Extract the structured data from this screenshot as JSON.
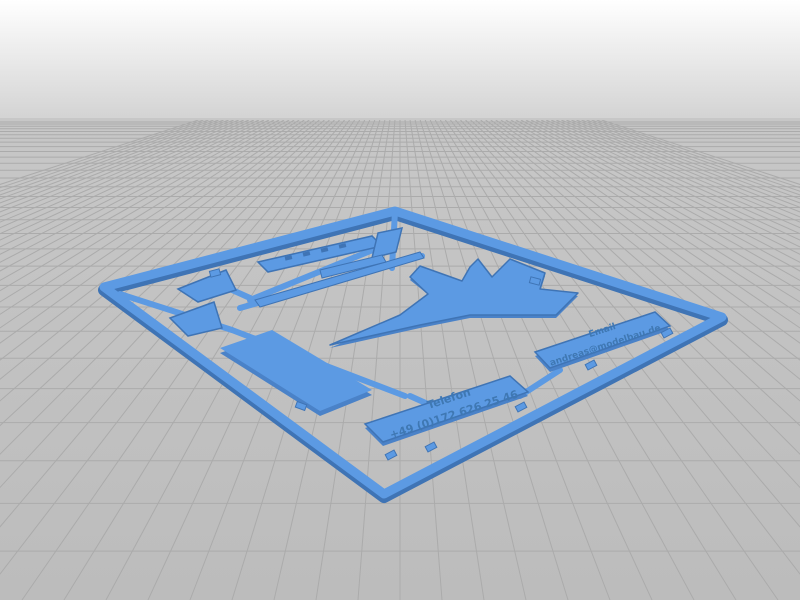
{
  "scene": {
    "subject": "3d-print-preview",
    "colors": {
      "sky_top": "#ffffff",
      "sky_bottom": "#d3d3d3",
      "floor": "#c0c0c0",
      "grid_line": "#a9a9a9",
      "part_fill": "#5c9ae3",
      "part_edge": "#3f74b5",
      "part_shadow": "#4a82c8"
    },
    "icons": {
      "aircraft": "jet-aircraft-icon"
    }
  },
  "plates": {
    "phone_label": "Telefon",
    "phone_number": "+49 (0)172 626 25 46",
    "email_label": "Email",
    "email_value": "andreas@modelbau.de"
  }
}
